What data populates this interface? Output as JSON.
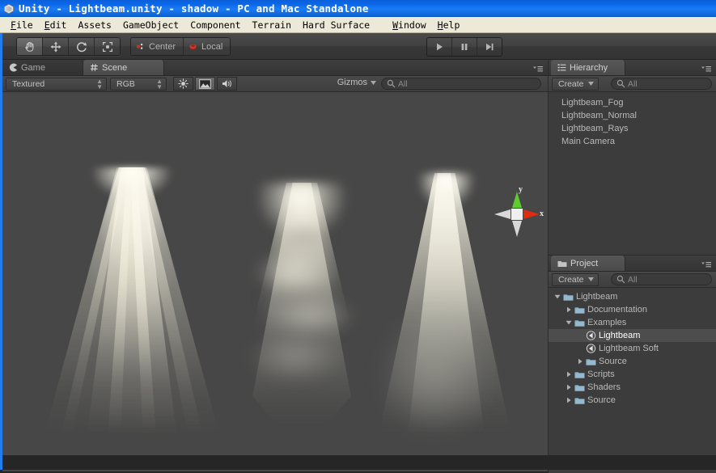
{
  "window": {
    "title": "Unity - Lightbeam.unity - shadow - PC and Mac Standalone",
    "icon": "unity-logo-icon"
  },
  "menubar": {
    "items": [
      {
        "label": "File",
        "mnemonic": "F"
      },
      {
        "label": "Edit",
        "mnemonic": "E"
      },
      {
        "label": "Assets",
        "mnemonic": ""
      },
      {
        "label": "GameObject",
        "mnemonic": ""
      },
      {
        "label": "Component",
        "mnemonic": ""
      },
      {
        "label": "Terrain",
        "mnemonic": ""
      },
      {
        "label": "Hard Surface",
        "mnemonic": ""
      },
      {
        "label": "Window",
        "mnemonic": "W"
      },
      {
        "label": "Help",
        "mnemonic": "H"
      }
    ]
  },
  "toolbar": {
    "transform_tools": [
      {
        "name": "hand-tool",
        "icon": "hand-icon",
        "active": true
      },
      {
        "name": "move-tool",
        "icon": "move-arrows-icon",
        "active": false
      },
      {
        "name": "rotate-tool",
        "icon": "rotate-icon",
        "active": false
      },
      {
        "name": "scale-tool",
        "icon": "scale-icon",
        "active": false
      }
    ],
    "pivot_mode": "Center",
    "pivot_rotation": "Local",
    "playback": [
      {
        "name": "play-button",
        "icon": "play-icon"
      },
      {
        "name": "pause-button",
        "icon": "pause-icon"
      },
      {
        "name": "step-button",
        "icon": "step-forward-icon"
      }
    ]
  },
  "scene_panel": {
    "tabs": [
      {
        "label": "Game",
        "icon": "game-pacman-icon",
        "selected": false
      },
      {
        "label": "Scene",
        "icon": "scene-grid-icon",
        "selected": true
      }
    ],
    "draw_mode": "Textured",
    "color_mode": "RGB",
    "toggles": [
      {
        "name": "lighting-toggle",
        "icon": "sun-icon",
        "on": false
      },
      {
        "name": "fx-toggle",
        "icon": "image-fx-icon",
        "on": true
      },
      {
        "name": "audio-toggle",
        "icon": "speaker-icon",
        "on": false
      }
    ],
    "gizmos_label": "Gizmos",
    "search_placeholder": "All",
    "search_value": "",
    "axis_gizmo": {
      "y_label": "y",
      "x_label": "x",
      "y_color": "#5ecb2f",
      "x_color": "#e02b14",
      "neutral_color": "#d8d8d8"
    },
    "background_color": "#474747",
    "beams": [
      {
        "name": "lightbeam-rays",
        "style": "rays"
      },
      {
        "name": "lightbeam-fog",
        "style": "fog"
      },
      {
        "name": "lightbeam-normal",
        "style": "normal"
      }
    ]
  },
  "hierarchy": {
    "tab_label": "Hierarchy",
    "tab_icon": "hierarchy-list-icon",
    "create_label": "Create",
    "search_placeholder": "All",
    "search_value": "",
    "items": [
      {
        "label": "Lightbeam_Fog",
        "selected": false
      },
      {
        "label": "Lightbeam_Normal",
        "selected": false
      },
      {
        "label": "Lightbeam_Rays",
        "selected": false
      },
      {
        "label": "Main Camera",
        "selected": false
      }
    ]
  },
  "project": {
    "tab_label": "Project",
    "tab_icon": "folder-icon",
    "create_label": "Create",
    "search_placeholder": "All",
    "search_value": "",
    "items": [
      {
        "label": "Lightbeam",
        "depth": 0,
        "twisty": "open",
        "icon": "folder-icon",
        "selected": false
      },
      {
        "label": "Documentation",
        "depth": 1,
        "twisty": "closed",
        "icon": "folder-icon",
        "selected": false
      },
      {
        "label": "Examples",
        "depth": 1,
        "twisty": "open",
        "icon": "folder-icon",
        "selected": false
      },
      {
        "label": "Lightbeam",
        "depth": 2,
        "twisty": "none",
        "icon": "prefab-icon",
        "selected": true
      },
      {
        "label": "Lightbeam Soft",
        "depth": 2,
        "twisty": "none",
        "icon": "prefab-icon",
        "selected": false
      },
      {
        "label": "Source",
        "depth": 2,
        "twisty": "closed",
        "icon": "folder-icon",
        "selected": false
      },
      {
        "label": "Scripts",
        "depth": 1,
        "twisty": "closed",
        "icon": "folder-icon",
        "selected": false
      },
      {
        "label": "Shaders",
        "depth": 1,
        "twisty": "closed",
        "icon": "folder-icon",
        "selected": false
      },
      {
        "label": "Source",
        "depth": 1,
        "twisty": "closed",
        "icon": "folder-icon",
        "selected": false
      }
    ]
  },
  "colors": {
    "title_blue": "#0a66e8",
    "menu_bg": "#ece9d8",
    "panel_bg": "#3c3c3c",
    "viewport_bg": "#474747",
    "selection": "#4d4d4d",
    "accent_border": "#1f7ded"
  }
}
